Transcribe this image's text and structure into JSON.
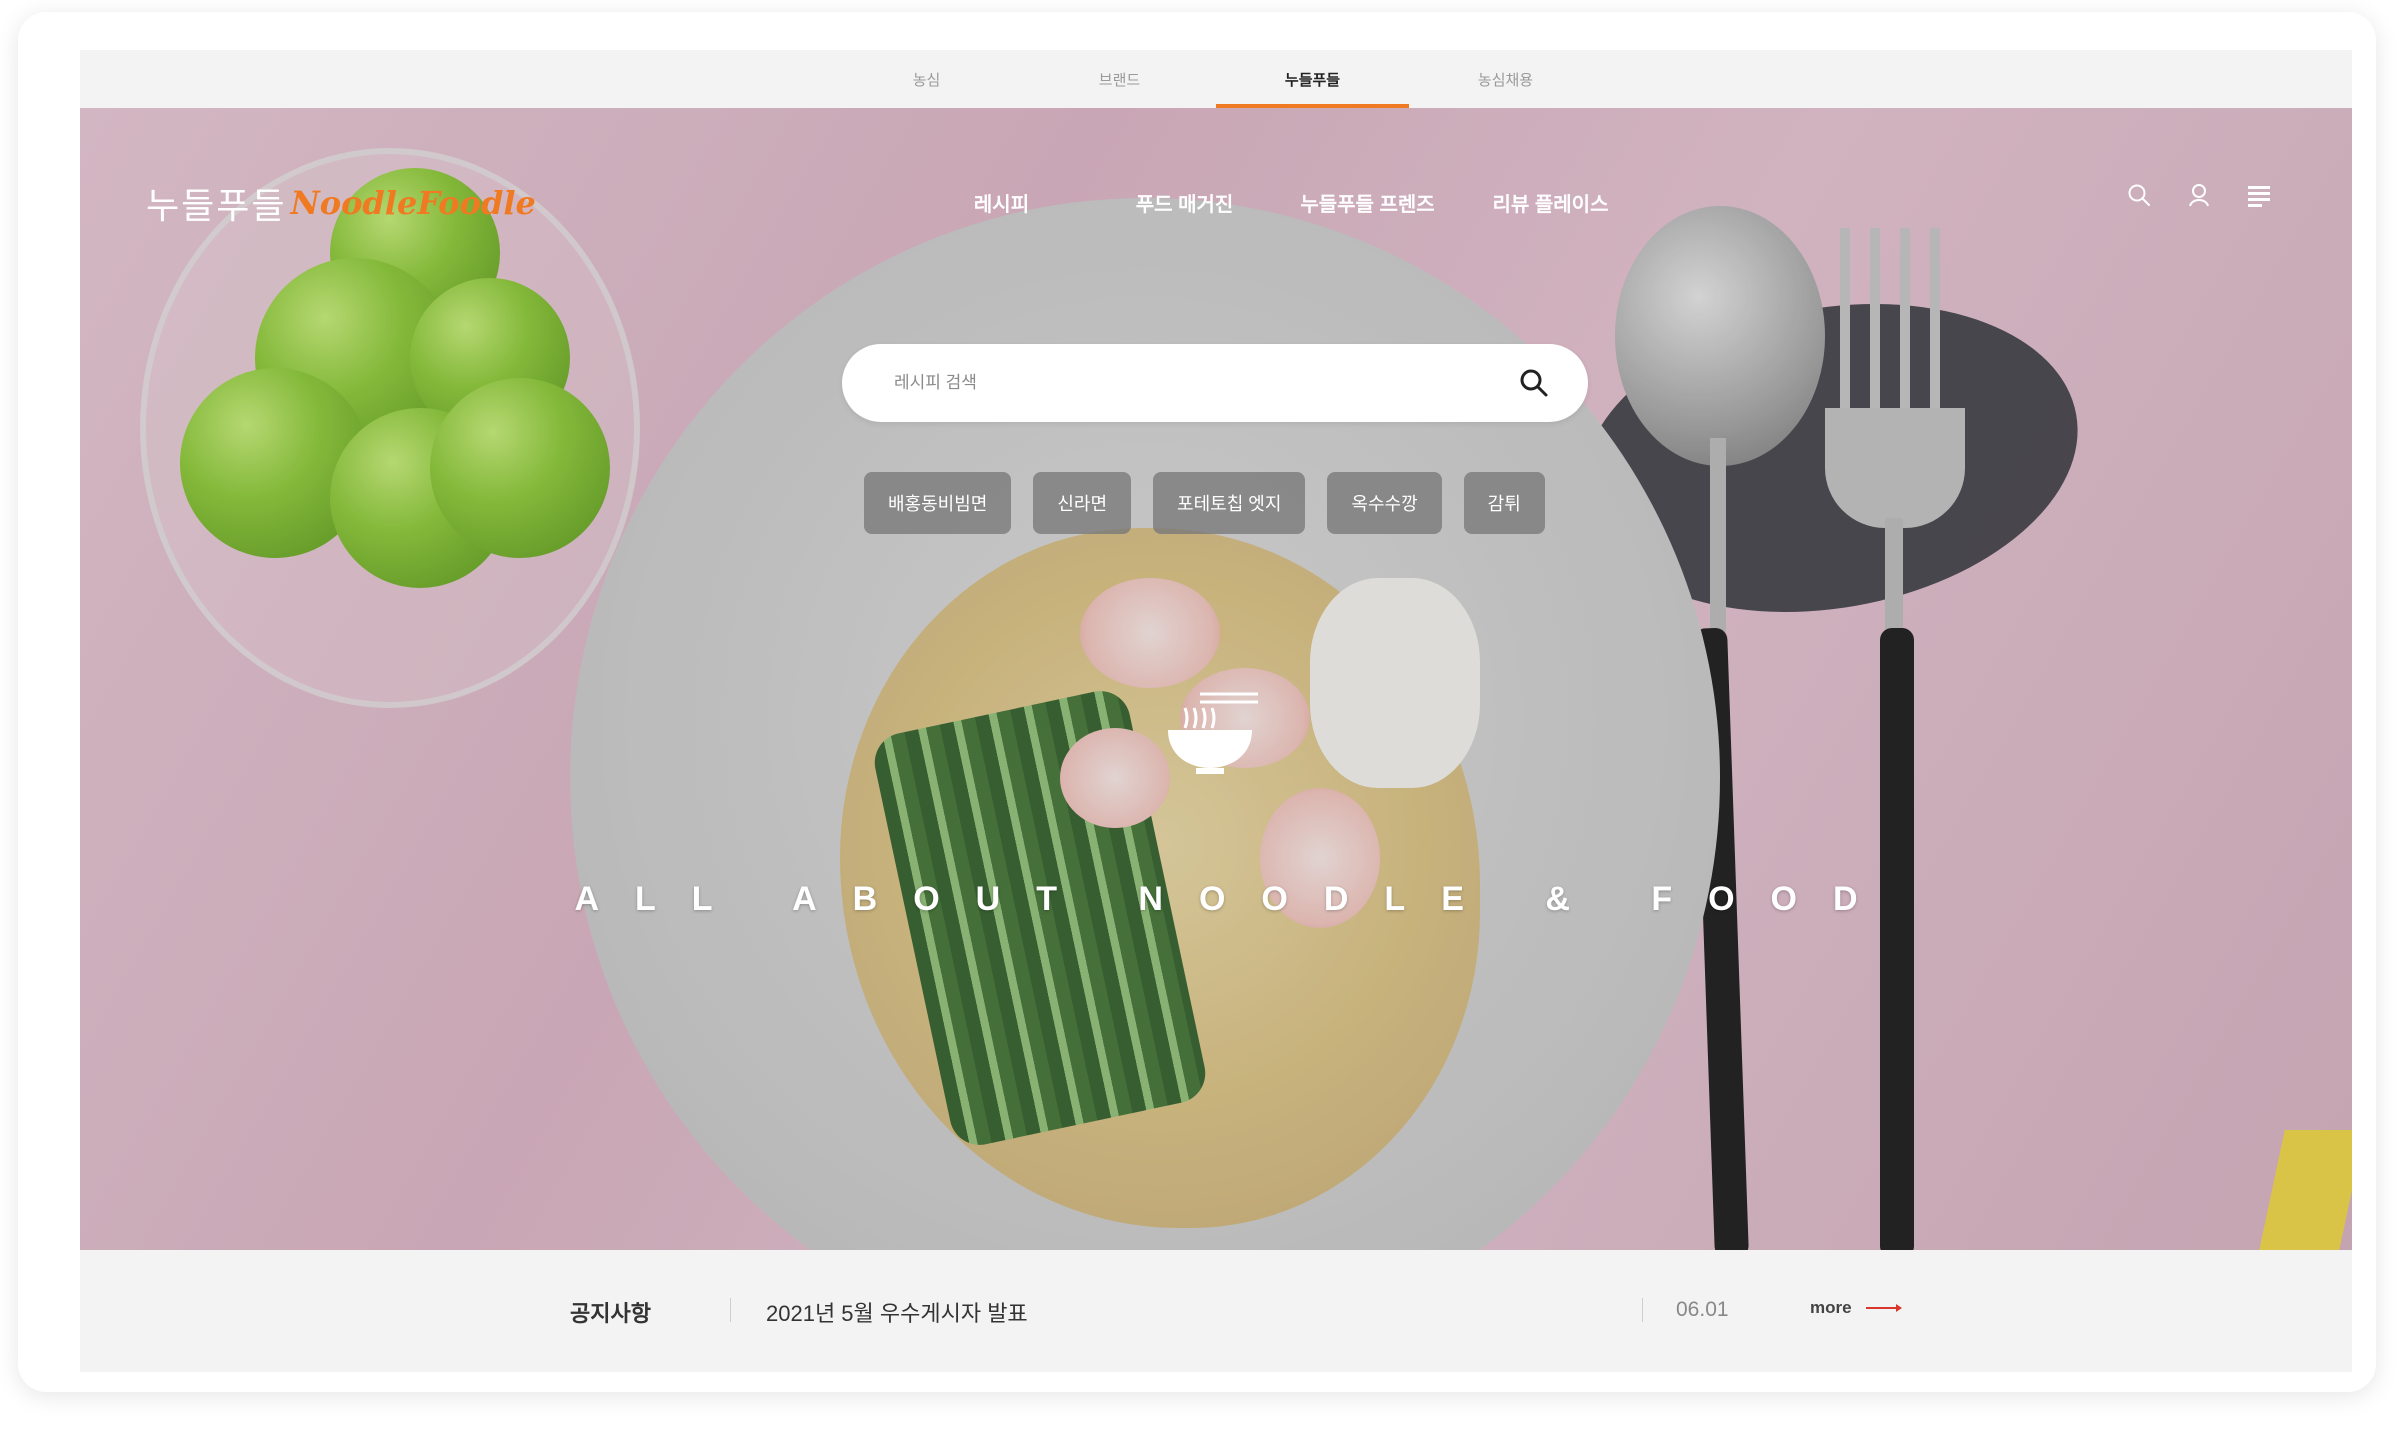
{
  "brand_tabs": [
    {
      "label": "농심",
      "active": false
    },
    {
      "label": "브랜드",
      "active": false
    },
    {
      "label": "누들푸들",
      "active": true
    },
    {
      "label": "농심채용",
      "active": false
    }
  ],
  "logo": {
    "korean": "누들푸들",
    "english": "NoodleFoodle"
  },
  "gnb": [
    "레시피",
    "푸드 매거진",
    "누들푸들 프렌즈",
    "리뷰 플레이스"
  ],
  "utility_icons": [
    "search-icon",
    "user-icon",
    "menu-icon"
  ],
  "search": {
    "placeholder": "레시피 검색"
  },
  "tags": [
    "배홍동비빔면",
    "신라면",
    "포테토칩 엣지",
    "옥수수깡",
    "감튀"
  ],
  "hero": {
    "slogan": "ALL ABOUT NOODLE & FOOD"
  },
  "notice": {
    "label": "공지사항",
    "title": "2021년 5월 우수게시자 발표",
    "date": "06.01",
    "more_label": "more"
  },
  "colors": {
    "accent": "#f07a22",
    "chip_bg": "#787878",
    "notice_bg": "#f3f3f3"
  }
}
